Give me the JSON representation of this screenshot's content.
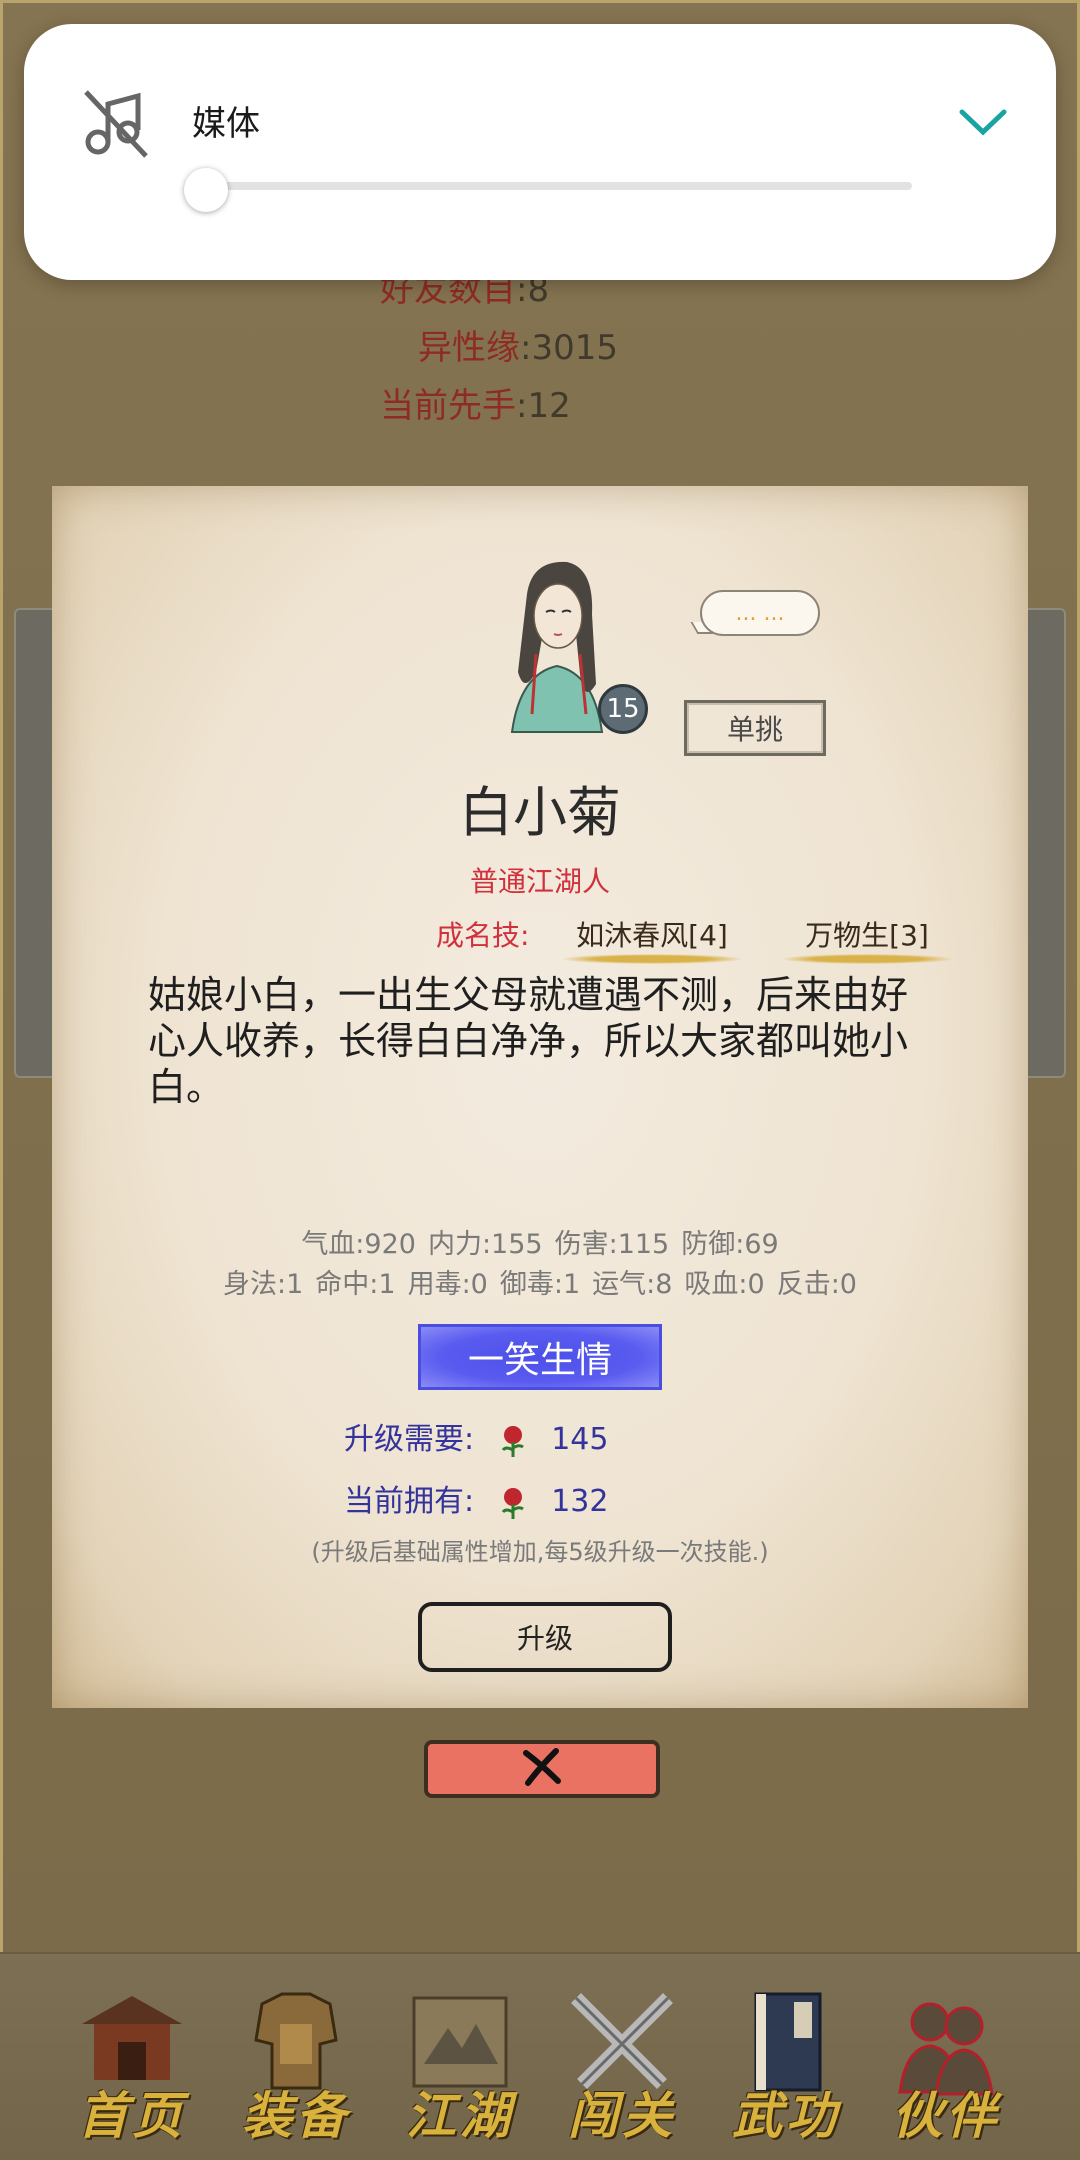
{
  "background_stats": [
    {
      "key": "好友数目",
      "value": "8"
    },
    {
      "key": "异性缘",
      "value": "3015"
    },
    {
      "key": "当前先手",
      "value": "12"
    }
  ],
  "volume": {
    "label": "媒体",
    "level": 0,
    "icon": "music-muted-icon",
    "expand_icon": "chevron-down-icon",
    "accent": "#1aa3a3"
  },
  "character": {
    "level": "15",
    "speech": "... ...",
    "duel_label": "单挑",
    "name": "白小菊",
    "rank": "普通江湖人",
    "skills_label": "成名技:",
    "skills": [
      "如沐春风[4]",
      "万物生[3]"
    ],
    "description": "姑娘小白，一出生父母就遭遇不测，后来由好心人收养，长得白白净净，所以大家都叫她小白。",
    "stats_line1": [
      "气血:920",
      "内力:155",
      "伤害:115",
      "防御:69"
    ],
    "stats_line2": [
      "身法:1",
      "命中:1",
      "用毒:0",
      "御毒:1",
      "运气:8",
      "吸血:0",
      "反击:0"
    ],
    "talent": "一笑生情",
    "upgrade_need_label": "升级需要:",
    "upgrade_need_value": "145",
    "owned_label": "当前拥有:",
    "owned_value": "132",
    "hint": "(升级后基础属性增加,每5级升级一次技能.)",
    "upgrade_label": "升级"
  },
  "colors": {
    "red_text": "#d0313c",
    "talent_blue": "#4c4fe8",
    "close_red": "#ea7262",
    "nav_gold": "#d8b23c"
  },
  "nav": [
    {
      "label": "首页",
      "icon": "temple-gate-icon"
    },
    {
      "label": "装备",
      "icon": "armor-icon"
    },
    {
      "label": "江湖",
      "icon": "scroll-map-icon"
    },
    {
      "label": "闯关",
      "icon": "crossed-swords-icon"
    },
    {
      "label": "武功",
      "icon": "martial-book-icon"
    },
    {
      "label": "伙伴",
      "icon": "companions-icon"
    }
  ]
}
